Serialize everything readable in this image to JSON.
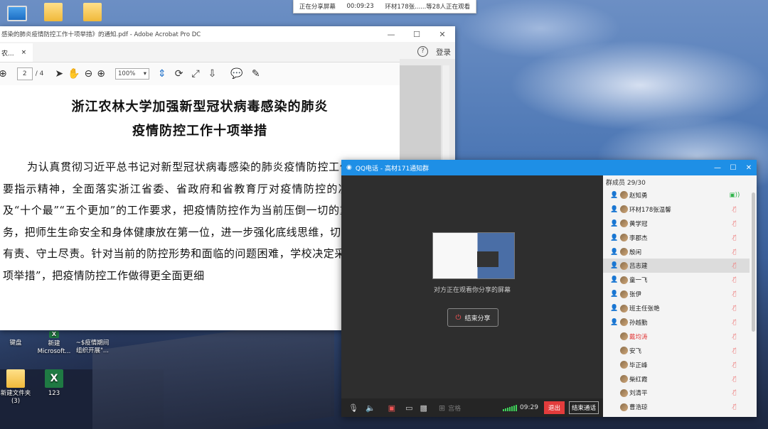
{
  "sharebar": {
    "label": "正在分享屏幕",
    "time": "00:09:23",
    "viewers": "环材178张......等28人正在观看"
  },
  "desktop": {
    "icons": [
      {
        "label": "",
        "kind": "monitor"
      },
      {
        "label": "",
        "kind": "folder"
      },
      {
        "label": "",
        "kind": "folder"
      },
      {
        "label": "键盘",
        "kind": "doc"
      },
      {
        "label": "新建 Microsoft...",
        "kind": "excel"
      },
      {
        "label": "~$疫情期间 组织开展\"...",
        "kind": "doc"
      },
      {
        "label": "新建文件夹 (3)",
        "kind": "folder"
      },
      {
        "label": "123",
        "kind": "excel"
      }
    ]
  },
  "acrobat": {
    "title": "感染的肺炎疫情防控工作十项举措》的通知.pdf - Adobe Acrobat Pro DC",
    "tab": "农...",
    "tab_close": "×",
    "help": "?",
    "login": "登录",
    "page_current": "2",
    "page_total": "/ 4",
    "zoom": "100%",
    "doc_title_1": "浙江农林大学加强新型冠状病毒感染的肺炎",
    "doc_title_2": "疫情防控工作十项举措",
    "doc_body": "为认真贯彻习近平总书记对新型冠状病毒感染的肺炎疫情防控工作作出的重要指示精神，全面落实浙江省委、省政府和省教育厅对疫情防控的决策部署以及“十个最”“五个更加”的工作要求，把疫情防控作为当前压倒一切的重大政治任务，把师生生命安全和身体健康放在第一位，进一步强化底线思维，切实做到守土有责、守土尽责。针对当前的防控形势和面临的问题困难，学校决定采取以下“十项举措”，把疫情防控工作做得更全面更细"
  },
  "qq": {
    "title": "QQ电话 - 高材171通知群",
    "share_status": "对方正在观看你分享的屏幕",
    "end_share": "结束分享",
    "palace": "宫格",
    "call_time": "09:29",
    "exit": "退出",
    "end_call": "结束通话",
    "members_header": "群成员 29/30",
    "members": [
      {
        "name": "赵知勇",
        "mic": "on"
      },
      {
        "name": "环材178张温馨",
        "mic": "off"
      },
      {
        "name": "黄学冠",
        "mic": "off"
      },
      {
        "name": "李郡杰",
        "mic": "off"
      },
      {
        "name": "殷闲",
        "mic": "off"
      },
      {
        "name": "吕志建",
        "mic": "off",
        "selected": true
      },
      {
        "name": "童一飞",
        "mic": "off"
      },
      {
        "name": "张伊",
        "mic": "off"
      },
      {
        "name": "班主任张艳",
        "mic": "off"
      },
      {
        "name": "孙越勤",
        "mic": "off"
      },
      {
        "name": "戴均涛",
        "mic": "off",
        "red": true
      },
      {
        "name": "安飞",
        "mic": "off"
      },
      {
        "name": "毕正峰",
        "mic": "off"
      },
      {
        "name": "柴红霞",
        "mic": "off"
      },
      {
        "name": "刘清平",
        "mic": "off"
      },
      {
        "name": "曹浩琼",
        "mic": "off"
      }
    ]
  }
}
